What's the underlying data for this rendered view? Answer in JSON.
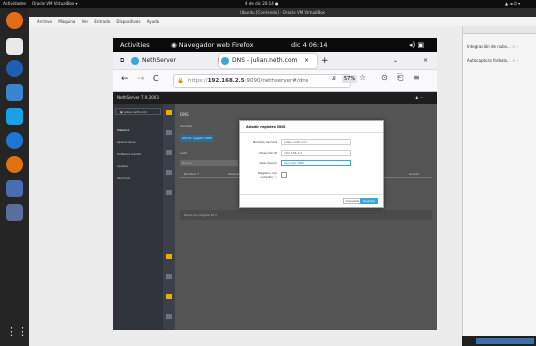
{
  "host_topbar": {
    "activities": "Actividades",
    "app": "Oracle VM VirtualBox ▾",
    "clock": "4 de dic 20:14 ●"
  },
  "vbox": {
    "title": "Ubuntu [Corriendo] - Oracle VM VirtualBox",
    "menu": [
      "Archivo",
      "Máquina",
      "Ver",
      "Entrada",
      "Dispositivos",
      "Ayuda"
    ]
  },
  "guest_topbar": {
    "activities": "Activities",
    "app": "Navegador web Firefox",
    "clock": "dic 4  06:14"
  },
  "firefox": {
    "tabs": [
      {
        "label": "NethServer"
      },
      {
        "label": "DNS - julian.neth.com"
      }
    ],
    "url_prefix": "https://",
    "url_host": "192.168.2.5",
    "url_rest": ":9090/nethserver#/dns",
    "zoom": "57%"
  },
  "nethserver": {
    "header_title": "NethServer 7.9.2003",
    "user_label": "julian.neth.com",
    "sidebar": [
      "Sistema",
      "Aplicaciones",
      "Software Center",
      "Ajustes",
      "Terminal"
    ],
    "page_title": "DNS",
    "section_label": "Servidor",
    "add_button": "Añadir registro DNS",
    "list_label": "Lista",
    "search_placeholder": "Buscar",
    "col_name": "Nombre ↑",
    "col_desc": "Descripción",
    "col_actions": "Acción",
    "pager": "Items por página 25 ▾"
  },
  "modal": {
    "title": "Añadir registro DNS",
    "fields": [
      {
        "label": "Nombre de host",
        "value": "julian.neth.com"
      },
      {
        "label": "Dirección IP",
        "value": "192.168.2.5"
      },
      {
        "label": "Descripción",
        "value": "Servidor DNS"
      }
    ],
    "wildcard_label": "Registro con comodín",
    "cancel": "Cancelar",
    "save": "Guardar"
  },
  "right_panel": {
    "items": [
      "Integración de nubs...",
      "Autocaptura forbala..."
    ]
  },
  "colors": {
    "nethserver_blue": "#39a5dc",
    "dark_header": "#1d1d1d",
    "sidebar": "#30343a"
  }
}
